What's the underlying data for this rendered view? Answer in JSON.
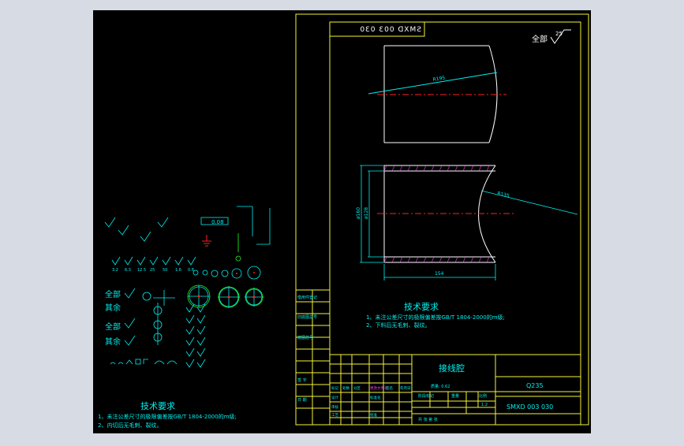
{
  "colors": {
    "background": "#d6dbe4",
    "canvas": "#000000",
    "border": "#f5f53a",
    "line": "#ffffff",
    "text": "#00f0f0",
    "dim": "#00f0f0",
    "center": "#ff2020",
    "symbol": "#20ff20",
    "accent": "#ff40ff"
  },
  "drawing": {
    "code_mirrored": "SMXD 003 030",
    "surface_finish_all": "全部",
    "surface_roughness": "25",
    "dim_r195": "R195",
    "dim_r135": "R135",
    "dim_d160": "ø160",
    "dim_d128": "ø128",
    "dim_154": "154",
    "tech_req_title": "技术要求",
    "tech_req_1": "1、未注公差尺寸的极限偏差按GB/T 1804-2000的m级;",
    "tech_req_2": "2、下料后无毛刺、裂纹。",
    "part_name": "接线腔",
    "material": "Q235",
    "drawing_number": "SMXD 003 030",
    "stage_label": "阶段标记",
    "weight_label": "重量",
    "scale_label": "比例",
    "scale_value": "1:2",
    "sheet_label": "共 张 第 张",
    "weight_row_label": "质量: 0.62",
    "side_rows": [
      "借用件登记",
      "旧底图总号",
      "底图总号",
      "签  字",
      "日  期"
    ],
    "sign_rows": [
      "标记",
      "处数",
      "分区",
      "更改文件号",
      "签名",
      "年月日",
      "设计",
      "标准化",
      "审核",
      "工艺",
      "批准"
    ]
  },
  "legend": {
    "tech_req_title": "技术要求",
    "tech_req_1": "1、未注公差尺寸的极限偏差按GB/T 1804-2000的m级;",
    "tech_req_2": "2、内切后无毛刺、裂纹。",
    "all_label_1": "全部",
    "rest_label_1": "其余",
    "all_label_2": "全部",
    "rest_label_2": "其余",
    "tolerance_value": "0.08",
    "roughness_values": [
      "3.2",
      "6.3",
      "12.5",
      "25",
      "50",
      "1.6",
      "0.8"
    ]
  }
}
